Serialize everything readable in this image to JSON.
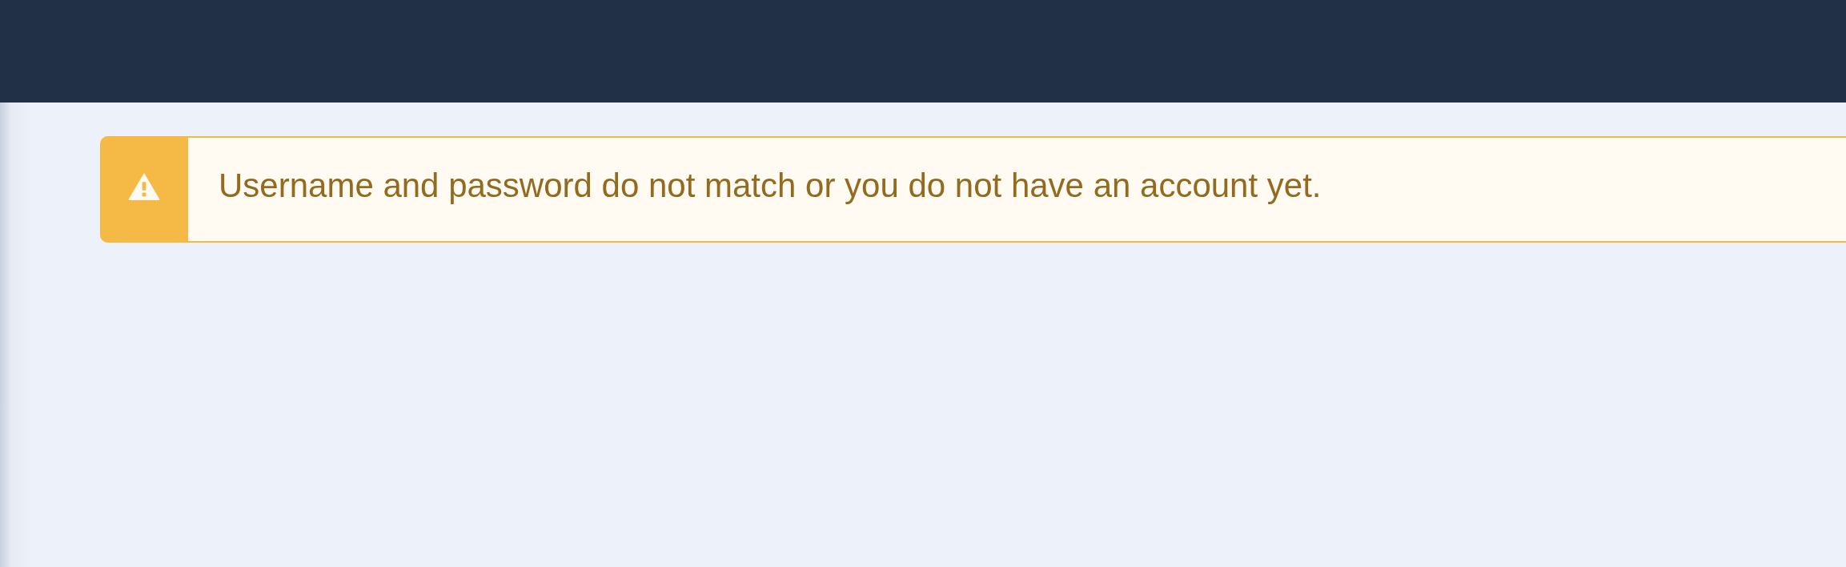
{
  "alert": {
    "kind": "warning",
    "message": "Username and password do not match or you do not have an account yet."
  }
}
